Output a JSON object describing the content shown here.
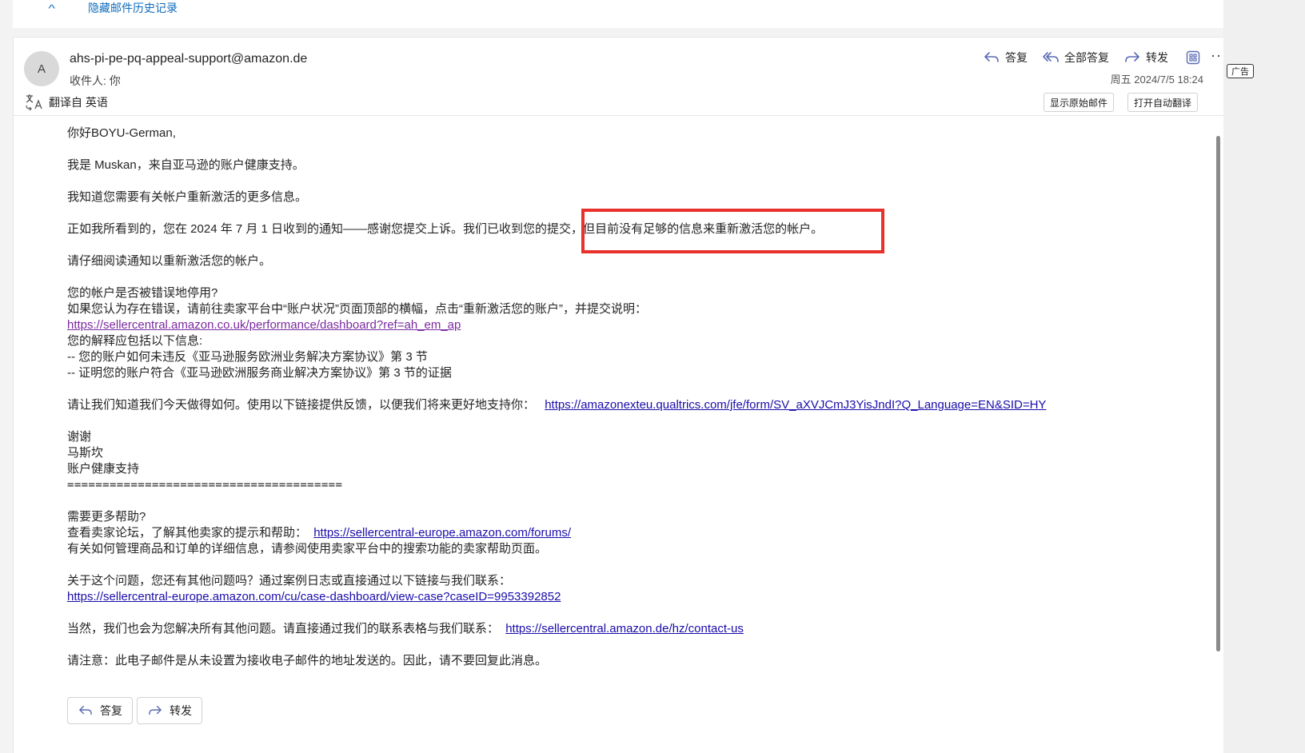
{
  "history": {
    "label": "隐藏邮件历史记录"
  },
  "email": {
    "avatar_initial": "A",
    "sender": "ahs-pi-pe-pq-appeal-support@amazon.de",
    "recipient_label": "收件人:",
    "recipient": "你",
    "timestamp": "周五 2024/7/5 18:24"
  },
  "actions": {
    "reply": "答复",
    "reply_all": "全部答复",
    "forward": "转发",
    "more_glyph": "···"
  },
  "translate": {
    "text": "翻译自 英语",
    "show_original": "显示原始邮件",
    "auto_translate": "打开自动翻译"
  },
  "body": {
    "greeting": "你好BOYU-German,",
    "intro": "我是 Muskan，来自亚马逊的账户健康支持。",
    "understand": "我知道您需要有关帐户重新激活的更多信息。",
    "notice": "正如我所看到的，您在 2024 年 7 月 1 日收到的通知——感谢您提交上诉。我们已收到您的提交，但目前没有足够的信息来重新激活您的帐户。",
    "read_carefully": "请仔细阅读通知以重新激活您的帐户。",
    "q_deactivated": "您的帐户是否被错误地停用?",
    "if_error": "如果您认为存在错误，请前往卖家平台中“账户状况”页面顶部的横幅，点击“重新激活您的账户”，并提交说明：",
    "link_dashboard": "https://sellercentral.amazon.co.uk/performance/dashboard?ref=ah_em_ap",
    "explain_include": "您的解释应包括以下信息:",
    "bullet1": "-- 您的账户如何未违反《亚马逊服务欧洲业务解决方案协议》第 3 节",
    "bullet2": "-- 证明您的账户符合《亚马逊欧洲服务商业解决方案协议》第 3 节的证据",
    "feedback_text": "请让我们知道我们今天做得如何。使用以下链接提供反馈，以便我们将来更好地支持你：",
    "link_feedback": "https://amazonexteu.qualtrics.com/jfe/form/SV_aXVJCmJ3YisJndI?Q_Language=EN&SID=HY",
    "thanks": "谢谢",
    "signer": "马斯坎",
    "team": "账户健康支持",
    "divider": "=======================================",
    "need_help": "需要更多帮助?",
    "forum_text": "查看卖家论坛，了解其他卖家的提示和帮助：",
    "link_forum": "https://sellercentral-europe.amazon.com/forums/",
    "manage_text": "有关如何管理商品和订单的详细信息，请参阅使用卖家平台中的搜索功能的卖家帮助页面。",
    "other_q": "关于这个问题，您还有其他问题吗？通过案例日志或直接通过以下链接与我们联系：",
    "link_case": "https://sellercentral-europe.amazon.com/cu/case-dashboard/view-case?caseID=9953392852",
    "contact_text": "当然，我们也会为您解决所有其他问题。请直接通过我们的联系表格与我们联系：",
    "link_contact": "https://sellercentral.amazon.de/hz/contact-us",
    "note": "请注意：此电子邮件是从未设置为接收电子邮件的地址发送的。因此，请不要回复此消息。"
  },
  "footer_buttons": {
    "reply": "答复",
    "forward": "转发"
  },
  "ad": {
    "label": "广告"
  },
  "colors": {
    "accent": "#0f6cbd",
    "highlight": "#e8312b",
    "link": "#1a0dab",
    "visited": "#7a2aa0"
  }
}
